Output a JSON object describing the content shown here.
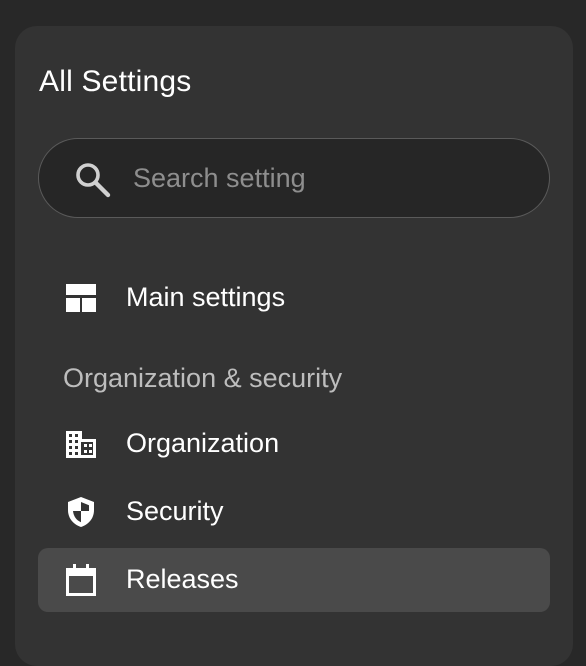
{
  "panel": {
    "title": "All Settings"
  },
  "search": {
    "placeholder": "Search setting",
    "value": "",
    "icon": "search-icon"
  },
  "nav": {
    "main_settings": {
      "label": "Main settings",
      "icon": "layout-icon"
    },
    "section_org_security": {
      "label": "Organization & security"
    },
    "organization": {
      "label": "Organization",
      "icon": "building-icon"
    },
    "security": {
      "label": "Security",
      "icon": "shield-icon"
    },
    "releases": {
      "label": "Releases",
      "icon": "calendar-icon",
      "active": true
    }
  },
  "colors": {
    "background": "#282828",
    "panel": "#333333",
    "search_field": "#262626",
    "active_item": "#4a4a4a",
    "text_primary": "#ffffff",
    "text_secondary": "#bdbdbd",
    "placeholder": "#8e8e8e"
  }
}
